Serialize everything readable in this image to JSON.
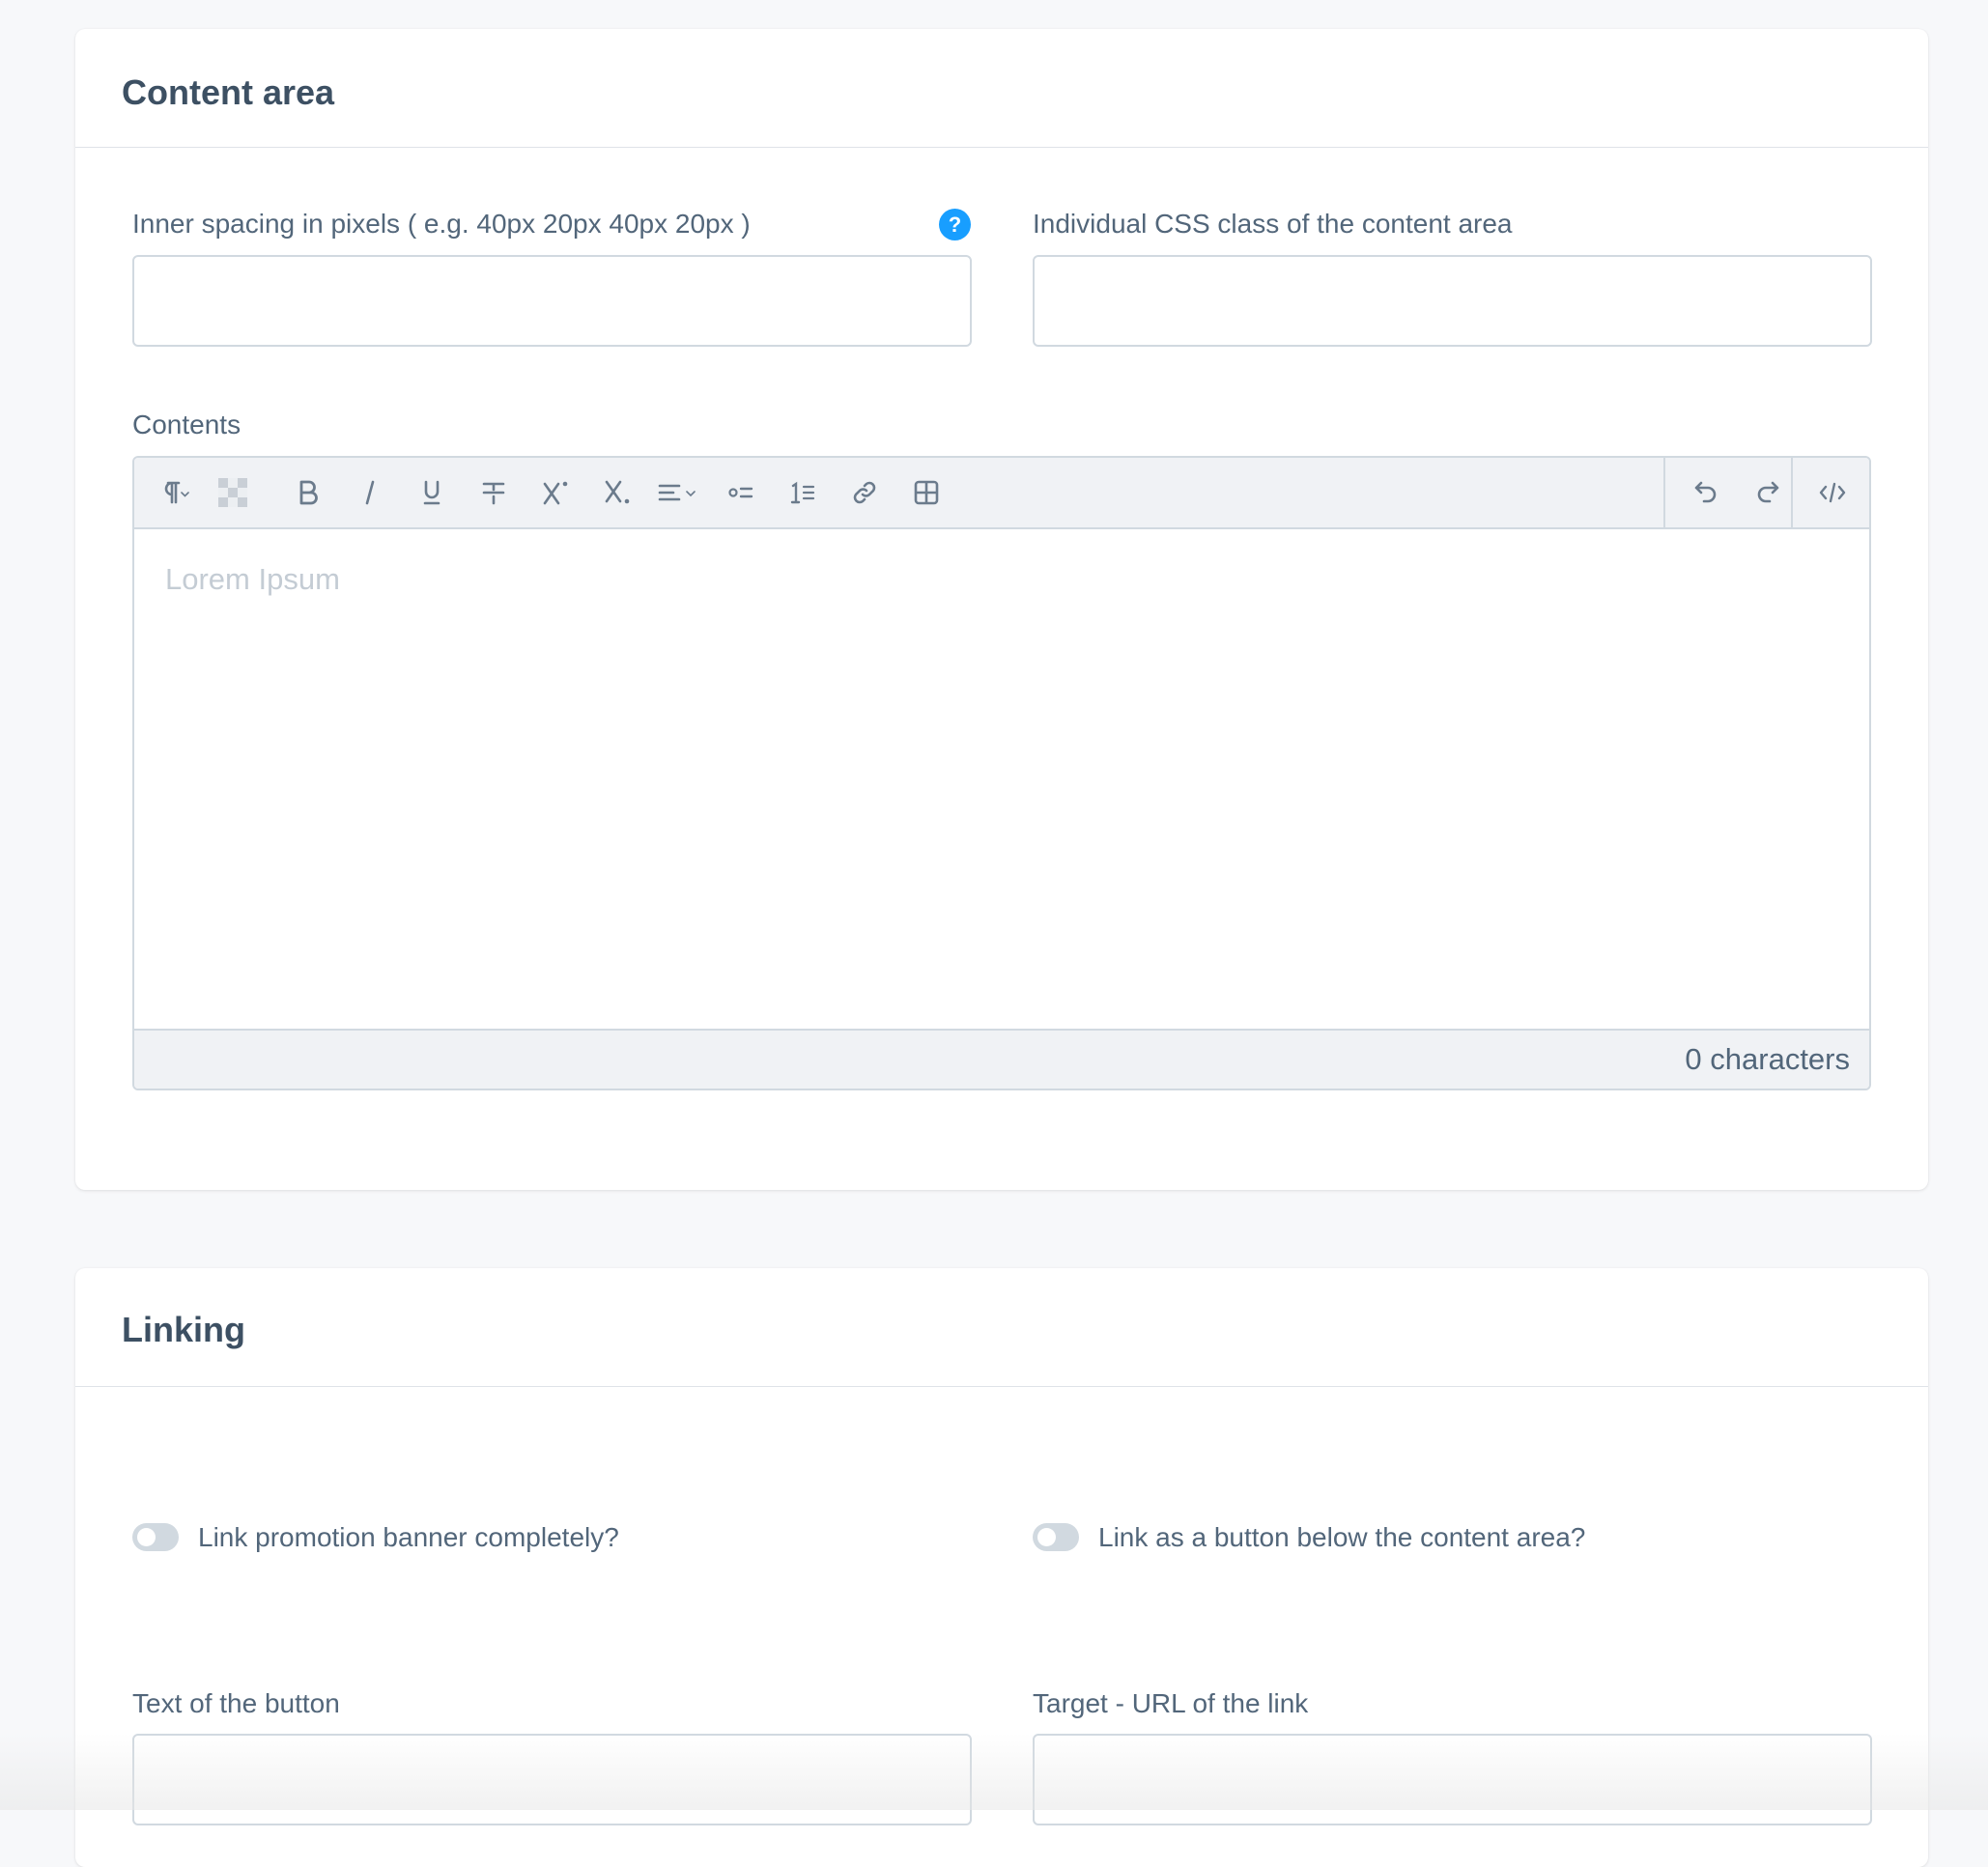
{
  "content_area": {
    "title": "Content area",
    "inner_spacing_label": "Inner spacing in pixels ( e.g. 40px 20px 40px 20px )",
    "inner_spacing_value": "",
    "help_symbol": "?",
    "css_class_label": "Individual CSS class of the content area",
    "css_class_value": "",
    "contents_label": "Contents",
    "editor": {
      "placeholder": "Lorem Ipsum",
      "char_count": "0 characters",
      "toolbar_icons": [
        "paragraph-icon",
        "text-color-icon",
        "bold-icon",
        "italic-icon",
        "underline-icon",
        "strikethrough-icon",
        "superscript-icon",
        "subscript-icon",
        "align-icon",
        "bullet-list-icon",
        "numbered-list-icon",
        "link-icon",
        "table-icon",
        "undo-icon",
        "redo-icon",
        "code-view-icon"
      ]
    }
  },
  "linking": {
    "title": "Linking",
    "toggle_banner_label": "Link promotion banner completely?",
    "toggle_banner_on": false,
    "toggle_button_label": "Link as a button below the content area?",
    "toggle_button_on": false,
    "button_text_label": "Text of the button",
    "button_text_value": "",
    "target_url_label": "Target - URL of the link",
    "target_url_value": ""
  },
  "colors": {
    "accent": "#189eff",
    "text": "#52667a",
    "title": "#3d5063",
    "border": "#d1d9e0",
    "toolbar_bg": "#f0f2f5",
    "page_bg": "#f7f8fa"
  }
}
